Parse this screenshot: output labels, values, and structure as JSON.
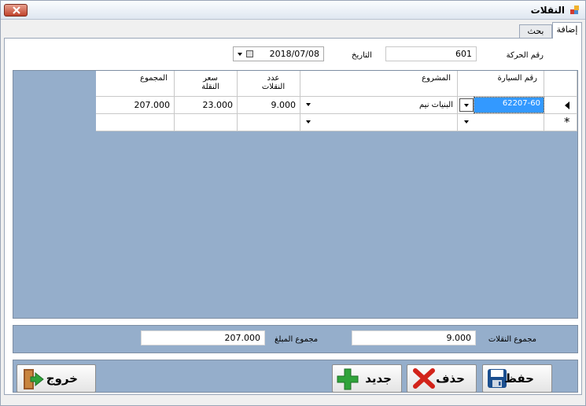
{
  "window": {
    "title": "النقلات"
  },
  "tabs": {
    "add": "إضافة",
    "search": "بحث"
  },
  "form": {
    "transaction_label": "رقم الحركة",
    "transaction_value": "601",
    "date_label": "التاريخ",
    "date_value": "2018/07/08"
  },
  "grid": {
    "columns": {
      "car": "رقم السيارة",
      "project": "المشروع",
      "count_line1": "عدد",
      "count_line2": "النقلات",
      "price_line1": "سعر",
      "price_line2": "النقلة",
      "total": "المجموع"
    },
    "rows": [
      {
        "car": "62207-60",
        "project": "البنيات نيم",
        "count": "9.000",
        "price": "23.000",
        "total": "207.000"
      }
    ],
    "new_row_marker": "*"
  },
  "totals": {
    "count_label": "مجموع النقلات",
    "count_value": "9.000",
    "amount_label": "مجموع المبلغ",
    "amount_value": "207.000"
  },
  "buttons": {
    "save": "حفظ",
    "delete": "حذف",
    "new": "جديد",
    "exit": "خروج"
  },
  "icons": {
    "close": "close-icon",
    "app": "app-icon",
    "save": "floppy-disk-icon",
    "delete": "red-x-icon",
    "new": "green-plus-icon",
    "exit": "door-exit-icon"
  },
  "colors": {
    "grid_background": "#95aecb",
    "selected_cell": "#3399ff",
    "close_button": "#c0432b"
  }
}
